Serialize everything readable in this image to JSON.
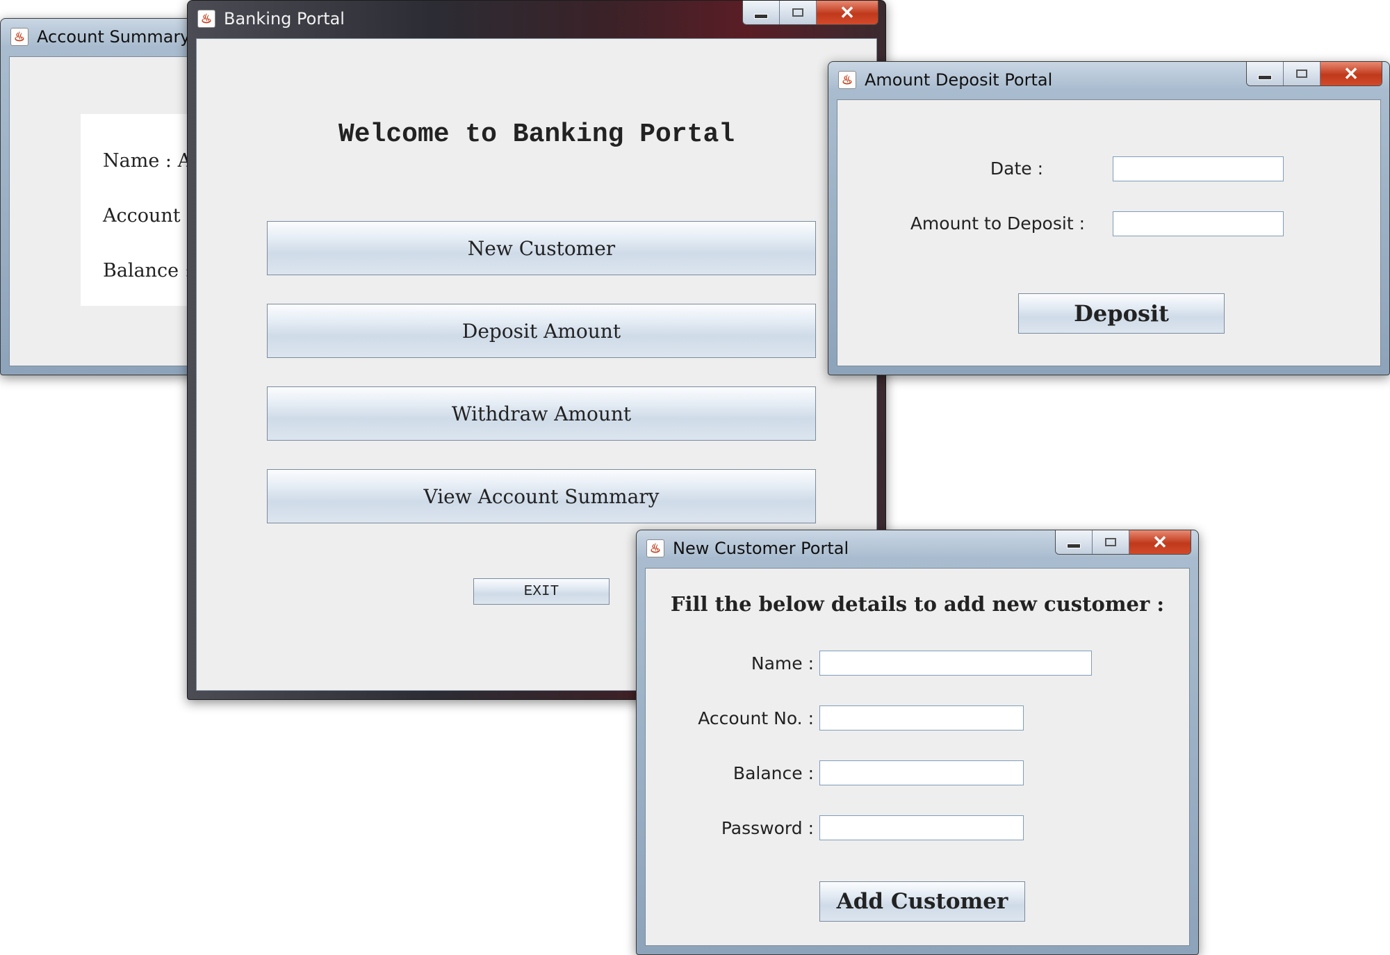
{
  "account_summary": {
    "title": "Account Summary",
    "fields": [
      {
        "label": "Name : A"
      },
      {
        "label": "Account N"
      },
      {
        "label": "Balance :"
      }
    ]
  },
  "banking_portal": {
    "title": "Banking Portal",
    "heading": "Welcome to Banking Portal",
    "buttons": {
      "new_customer": "New Customer",
      "deposit_amount": "Deposit Amount",
      "withdraw_amount": "Withdraw Amount",
      "view_summary": "View Account Summary"
    },
    "exit_label": "EXIT"
  },
  "deposit_portal": {
    "title": "Amount Deposit Portal",
    "date_label": "Date :",
    "date_value": "",
    "amount_label": "Amount to Deposit :",
    "amount_value": "",
    "deposit_button": "Deposit"
  },
  "new_customer_portal": {
    "title": "New Customer Portal",
    "heading": "Fill the below details to add new customer :",
    "name_label": "Name :",
    "account_label": "Account No. :",
    "balance_label": "Balance :",
    "password_label": "Password :",
    "add_button": "Add Customer"
  },
  "window_controls": {
    "close_glyph": "✕",
    "app_icon_glyph": "♨"
  }
}
